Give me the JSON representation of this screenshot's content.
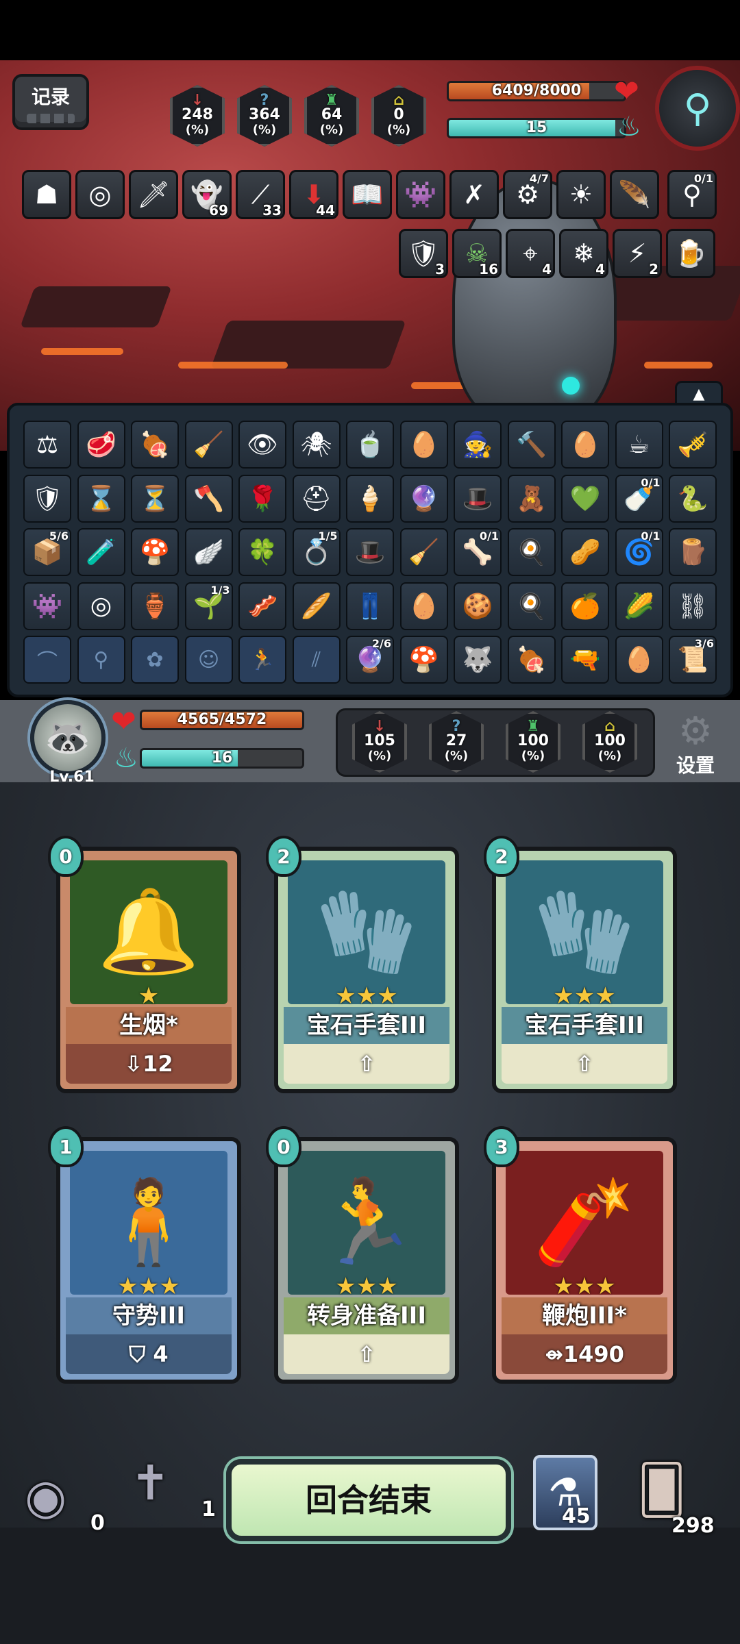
{
  "top_bar": {
    "log_label": "记录"
  },
  "enemy": {
    "hp_text": "6409/8000",
    "hp_fraction": 0.8,
    "energy_text": "15",
    "energy_fraction": 0.95,
    "stats": [
      {
        "value": "248",
        "pct": "(%)",
        "icon": "↓",
        "color": "#c94a4a"
      },
      {
        "value": "364",
        "pct": "(%)",
        "icon": "?",
        "color": "#5f9fc2"
      },
      {
        "value": "64",
        "pct": "(%)",
        "icon": "♜",
        "color": "#4fc36a"
      },
      {
        "value": "0",
        "pct": "(%)",
        "icon": "⌂",
        "color": "#cfc23a"
      }
    ],
    "buffs_row1": [
      {
        "icon": "☗",
        "count": ""
      },
      {
        "icon": "◎",
        "count": ""
      },
      {
        "icon": "🗡",
        "count": ""
      },
      {
        "icon": "👻",
        "count": "69"
      },
      {
        "icon": "⟋",
        "count": "33"
      },
      {
        "icon": "⬇",
        "count": "44"
      },
      {
        "icon": "📖",
        "count": ""
      },
      {
        "icon": "👾",
        "count": ""
      },
      {
        "icon": "✗",
        "count": ""
      },
      {
        "icon": "⚙",
        "count": "",
        "frac": "4/7"
      },
      {
        "icon": "☀",
        "count": ""
      },
      {
        "icon": "🪶",
        "count": ""
      },
      {
        "icon": "⚲",
        "count": "",
        "frac": "0/1"
      }
    ],
    "buffs_row2": [
      {
        "icon": "🛡",
        "count": "3"
      },
      {
        "icon": "☠",
        "count": "16"
      },
      {
        "icon": "⌖",
        "count": "4"
      },
      {
        "icon": "❄",
        "count": "4"
      },
      {
        "icon": "⚡",
        "count": "2"
      },
      {
        "icon": "🍺",
        "count": ""
      }
    ]
  },
  "relics": [
    [
      {
        "i": "⚖"
      },
      {
        "i": "🥩"
      },
      {
        "i": "🍖"
      },
      {
        "i": "🧹"
      },
      {
        "i": "👁"
      },
      {
        "i": "🕷"
      },
      {
        "i": "🍵"
      },
      {
        "i": "🥚"
      },
      {
        "i": "🧙"
      },
      {
        "i": "🔨"
      },
      {
        "i": "🥚"
      },
      {
        "i": "☕"
      },
      {
        "i": "🎺"
      }
    ],
    [
      {
        "i": "🛡"
      },
      {
        "i": "⌛"
      },
      {
        "i": "⏳"
      },
      {
        "i": "🪓"
      },
      {
        "i": "🌹"
      },
      {
        "i": "⛑"
      },
      {
        "i": "🍦"
      },
      {
        "i": "🔮"
      },
      {
        "i": "🎩"
      },
      {
        "i": "🧸"
      },
      {
        "i": "💚"
      },
      {
        "i": "🍼",
        "f": "0/1"
      },
      {
        "i": "🐍"
      }
    ],
    [
      {
        "i": "📦",
        "f": "5/6"
      },
      {
        "i": "🧪"
      },
      {
        "i": "🍄"
      },
      {
        "i": "🪽"
      },
      {
        "i": "🍀"
      },
      {
        "i": "💍",
        "f": "1/5"
      },
      {
        "i": "🎩"
      },
      {
        "i": "🧹"
      },
      {
        "i": "🦴",
        "f": "0/1"
      },
      {
        "i": "🍳"
      },
      {
        "i": "🥜"
      },
      {
        "i": "🌀",
        "f": "0/1"
      },
      {
        "i": "🪵"
      }
    ],
    [
      {
        "i": "👾"
      },
      {
        "i": "◎"
      },
      {
        "i": "🏺"
      },
      {
        "i": "🌱",
        "f": "1/3"
      },
      {
        "i": "🥓"
      },
      {
        "i": "🥖"
      },
      {
        "i": "👖"
      },
      {
        "i": "🥚"
      },
      {
        "i": "🍪"
      },
      {
        "i": "🍳"
      },
      {
        "i": "🍊"
      },
      {
        "i": "🌽"
      },
      {
        "i": "⛓"
      }
    ],
    [
      {
        "i": "⌒",
        "d": 1
      },
      {
        "i": "⚲",
        "d": 1
      },
      {
        "i": "✿",
        "d": 1
      },
      {
        "i": "☺",
        "d": 1
      },
      {
        "i": "🏃",
        "d": 1
      },
      {
        "i": "⫽",
        "d": 1
      },
      {
        "i": "🔮",
        "f": "2/6"
      },
      {
        "i": "🍄"
      },
      {
        "i": "🐺"
      },
      {
        "i": "🍖"
      },
      {
        "i": "🔫"
      },
      {
        "i": "🥚"
      },
      {
        "i": "📜",
        "f": "3/6"
      }
    ]
  ],
  "player": {
    "level": "Lv.61",
    "hp_text": "4565/4572",
    "hp_fraction": 0.998,
    "energy_text": "16",
    "energy_fraction": 0.6,
    "stats": [
      {
        "value": "105",
        "pct": "(%)",
        "icon": "↓",
        "color": "#c94a4a"
      },
      {
        "value": "27",
        "pct": "(%)",
        "icon": "?",
        "color": "#5f9fc2"
      },
      {
        "value": "100",
        "pct": "(%)",
        "icon": "♜",
        "color": "#4fc36a"
      },
      {
        "value": "100",
        "pct": "(%)",
        "icon": "⌂",
        "color": "#cfc23a"
      }
    ],
    "settings_label": "设置"
  },
  "hand": [
    {
      "name": "生烟*",
      "cost": "0",
      "stars": "★",
      "effect": "⇩12",
      "art": "🔔",
      "frame": "#c98a6a",
      "art_bg": "#2f5a25",
      "name_bg": "#b8734f",
      "effect_bg": "#8a4a3a"
    },
    {
      "name": "宝石手套III",
      "cost": "2",
      "stars": "★★★",
      "effect": "⇧",
      "art": "🧤",
      "frame": "#b8d3b0",
      "art_bg": "#2f6a7a",
      "name_bg": "#5a8f9a",
      "effect_bg": "#e8e6c9"
    },
    {
      "name": "宝石手套III",
      "cost": "2",
      "stars": "★★★",
      "effect": "⇧",
      "art": "🧤",
      "frame": "#b8d3b0",
      "art_bg": "#2f6a7a",
      "name_bg": "#5a8f9a",
      "effect_bg": "#e8e6c9"
    },
    {
      "name": "守势III",
      "cost": "1",
      "stars": "★★★",
      "effect": "⛉ 4",
      "art": "🧍",
      "frame": "#7fa0c8",
      "art_bg": "#3a6a9a",
      "name_bg": "#5a7fa5",
      "effect_bg": "#3f5a7a"
    },
    {
      "name": "转身准备III",
      "cost": "0",
      "stars": "★★★",
      "effect": "⇧",
      "art": "🏃",
      "frame": "#9fa7a2",
      "art_bg": "#2d5a5a",
      "name_bg": "#8faa6a",
      "effect_bg": "#e8e6c9"
    },
    {
      "name": "鞭炮III*",
      "cost": "3",
      "stars": "★★★",
      "effect": "⇴1490",
      "art": "🧨",
      "frame": "#d99a8a",
      "art_bg": "#7a1f1f",
      "name_bg": "#b8734f",
      "effect_bg": "#8a4a3a"
    }
  ],
  "bottom": {
    "draw_pile_count": "0",
    "discard_count": "1",
    "end_turn_label": "回合结束",
    "potion_count": "45",
    "deck_count": "298"
  }
}
